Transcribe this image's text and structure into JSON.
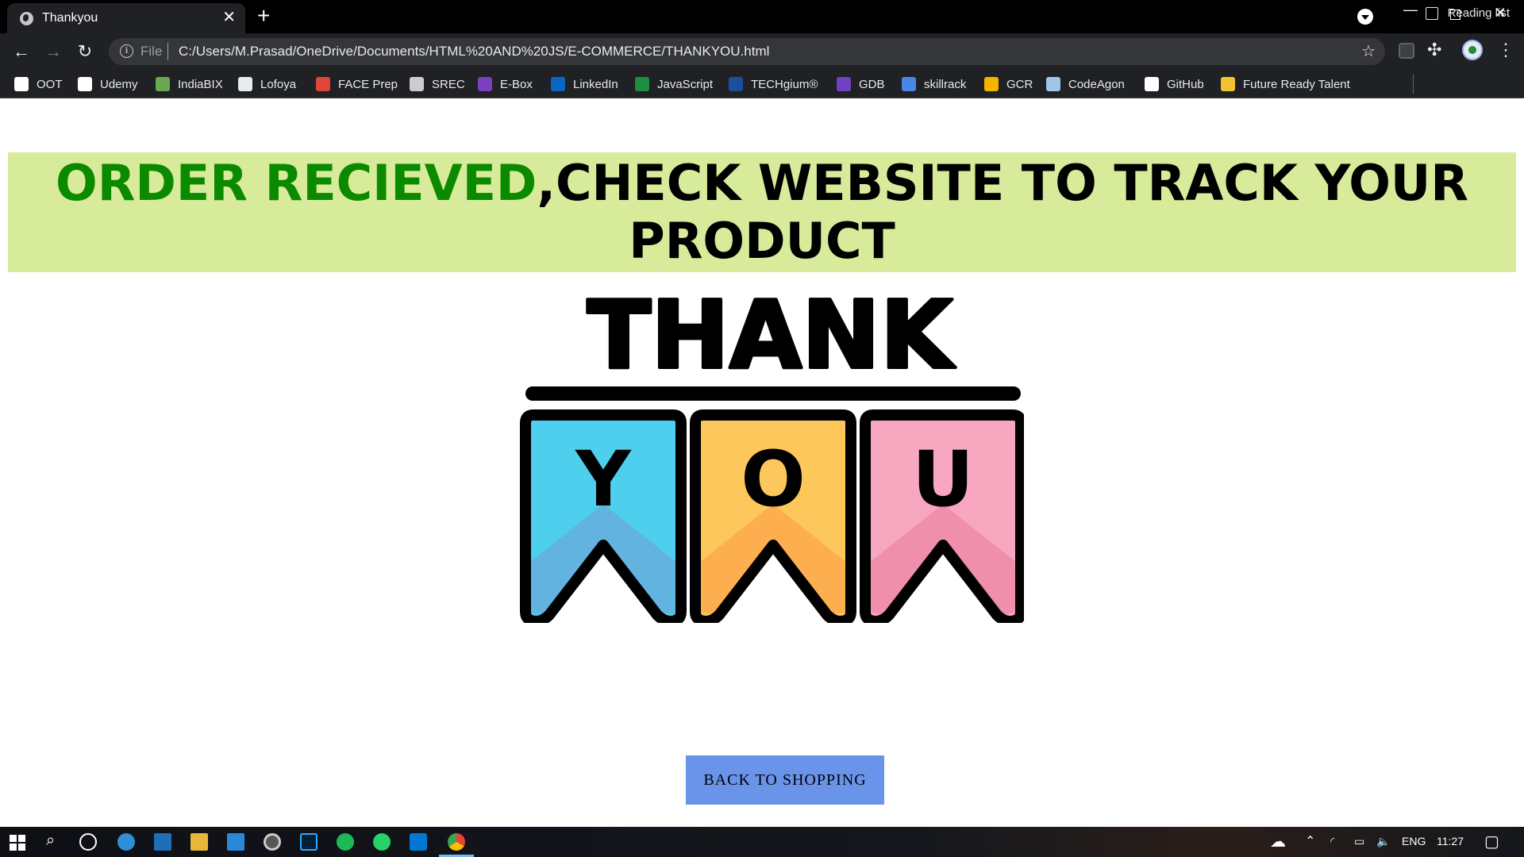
{
  "browser": {
    "tab_title": "Thankyou",
    "tab_close": "✕",
    "new_tab": "+",
    "url_protocol": "File",
    "url": "C:/Users/M.Prasad/OneDrive/Documents/HTML%20AND%20JS/E-COMMERCE/THANKYOU.html",
    "bookmarks": [
      {
        "label": "OOT",
        "color": "#ffffff"
      },
      {
        "label": "Udemy",
        "color": "#ffffff"
      },
      {
        "label": "IndiaBIX",
        "color": "#6aa84f"
      },
      {
        "label": "Lofoya",
        "color": "#e8eaed"
      },
      {
        "label": "FACE Prep",
        "color": "#e0453a"
      },
      {
        "label": "SREC",
        "color": "#cccccc"
      },
      {
        "label": "E-Box",
        "color": "#7b3fbf"
      },
      {
        "label": "LinkedIn",
        "color": "#0a66c2"
      },
      {
        "label": "JavaScript",
        "color": "#1e8e3e"
      },
      {
        "label": "TECHgium®",
        "color": "#1a4fa0"
      },
      {
        "label": "GDB",
        "color": "#6f42c1"
      },
      {
        "label": "skillrack",
        "color": "#4a86e8"
      },
      {
        "label": "GCR",
        "color": "#f4b400"
      },
      {
        "label": "CodeAgon",
        "color": "#9fc5e8"
      },
      {
        "label": "GitHub",
        "color": "#ffffff"
      },
      {
        "label": "Future Ready Talent",
        "color": "#f1c232"
      }
    ],
    "reading_list": "Reading list"
  },
  "page": {
    "banner_highlight": "ORDER RECIEVED",
    "banner_text": ",CHECK WEBSITE TO TRACK YOUR PRODUCT",
    "art": {
      "word_top": "THANK",
      "letters": [
        "Y",
        "O",
        "U"
      ],
      "flag_colors": [
        "#4fcfee",
        "#fdc75b",
        "#f7a8c0"
      ],
      "flag_shade_colors": [
        "#63b3e1",
        "#fdaf50",
        "#f08fab"
      ]
    },
    "back_button": "BACK TO SHOPPING"
  },
  "taskbar": {
    "language": "ENG",
    "time": "11:27"
  }
}
